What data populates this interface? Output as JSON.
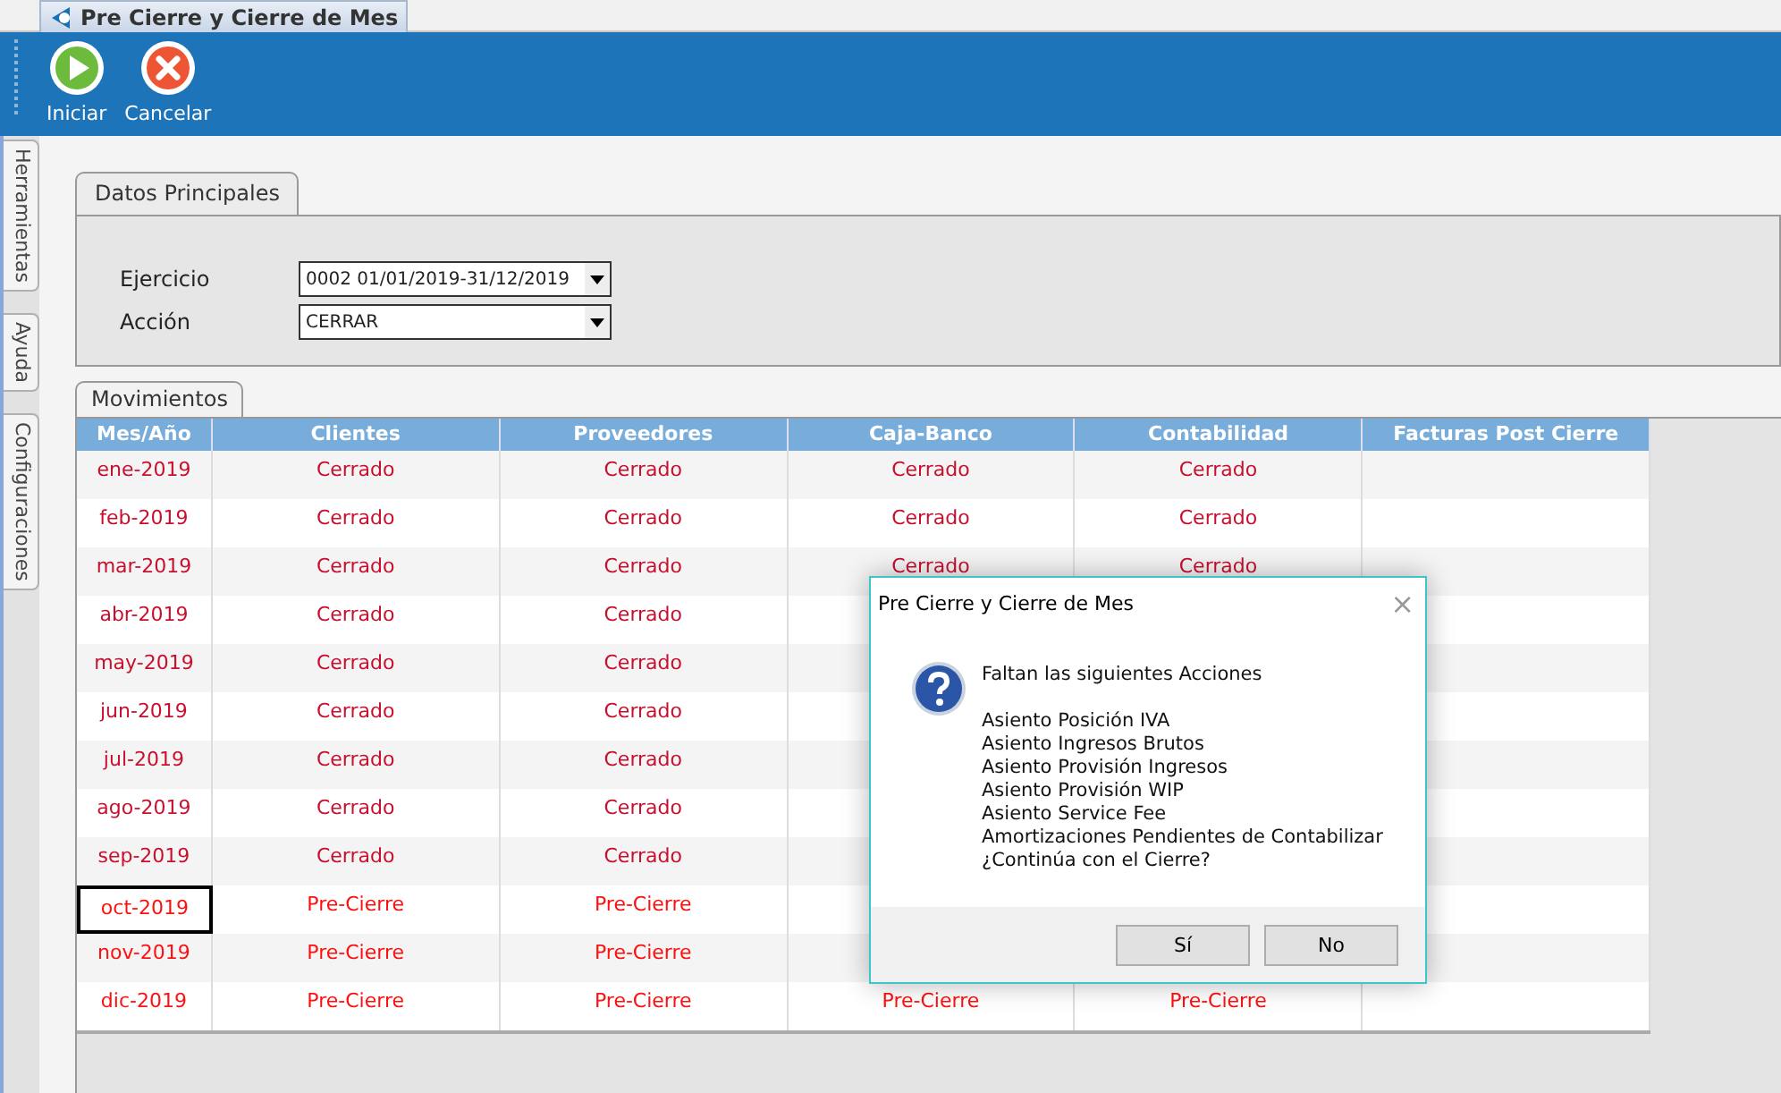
{
  "window": {
    "tab_title": "Pre Cierre y Cierre de Mes"
  },
  "toolbar": [
    {
      "label": "Iniciar",
      "kind": "start"
    },
    {
      "label": "Cancelar",
      "kind": "cancel"
    }
  ],
  "side_tabs": [
    "Herramientas",
    "Ayuda",
    "Configuraciones"
  ],
  "main_panel": {
    "tab": "Datos Principales",
    "fields": [
      {
        "label": "Ejercicio",
        "value": "0002 01/01/2019-31/12/2019"
      },
      {
        "label": "Acción",
        "value": "CERRAR"
      }
    ]
  },
  "movements": {
    "tab": "Movimientos",
    "columns": [
      "Mes/Año",
      "Clientes",
      "Proveedores",
      "Caja-Banco",
      "Contabilidad",
      "Facturas Post Cierre"
    ],
    "rows": [
      {
        "closed": true,
        "selected": false,
        "cells": [
          "ene-2019",
          "Cerrado",
          "Cerrado",
          "Cerrado",
          "Cerrado"
        ]
      },
      {
        "closed": true,
        "selected": false,
        "cells": [
          "feb-2019",
          "Cerrado",
          "Cerrado",
          "Cerrado",
          "Cerrado"
        ]
      },
      {
        "closed": true,
        "selected": false,
        "cells": [
          "mar-2019",
          "Cerrado",
          "Cerrado",
          "Cerrado",
          "Cerrado"
        ]
      },
      {
        "closed": true,
        "selected": false,
        "cells": [
          "abr-2019",
          "Cerrado",
          "Cerrado"
        ]
      },
      {
        "closed": true,
        "selected": false,
        "cells": [
          "may-2019",
          "Cerrado",
          "Cerrado"
        ]
      },
      {
        "closed": true,
        "selected": false,
        "cells": [
          "jun-2019",
          "Cerrado",
          "Cerrado"
        ]
      },
      {
        "closed": true,
        "selected": false,
        "cells": [
          "jul-2019",
          "Cerrado",
          "Cerrado"
        ]
      },
      {
        "closed": true,
        "selected": false,
        "cells": [
          "ago-2019",
          "Cerrado",
          "Cerrado"
        ]
      },
      {
        "closed": true,
        "selected": false,
        "cells": [
          "sep-2019",
          "Cerrado",
          "Cerrado"
        ]
      },
      {
        "closed": false,
        "selected": true,
        "cells": [
          "oct-2019",
          "Pre-Cierre",
          "Pre-Cierre"
        ]
      },
      {
        "closed": false,
        "selected": false,
        "cells": [
          "nov-2019",
          "Pre-Cierre",
          "Pre-Cierre"
        ]
      },
      {
        "closed": false,
        "selected": false,
        "cells": [
          "dic-2019",
          "Pre-Cierre",
          "Pre-Cierre",
          "Pre-Cierre",
          "Pre-Cierre"
        ]
      }
    ]
  },
  "dialog": {
    "title": "Pre Cierre y Cierre de Mes",
    "close": "×",
    "heading": "Faltan las siguientes Acciones",
    "lines": [
      "Asiento Posición IVA",
      "Asiento Ingresos Brutos",
      "Asiento Provisión Ingresos",
      "Asiento Provisión WIP",
      "Asiento Service Fee",
      "Amortizaciones Pendientes de Contabilizar",
      "¿Continúa con el Cierre?"
    ],
    "buttons": [
      "Sí",
      "No"
    ]
  }
}
